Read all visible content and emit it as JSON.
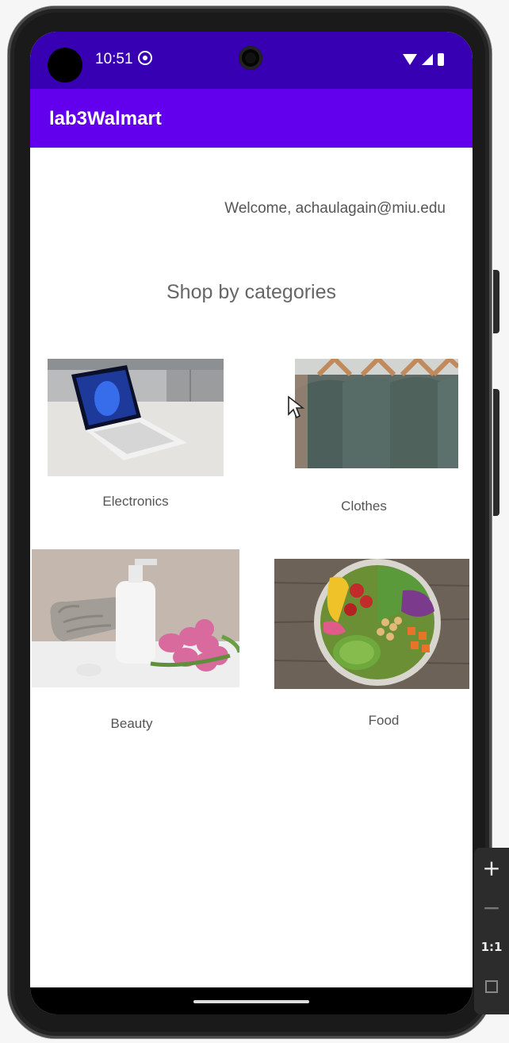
{
  "status_bar": {
    "time": "10:51",
    "icons": [
      "settings-icon",
      "wifi-icon",
      "signal-icon",
      "battery-icon"
    ],
    "background": "#3700b3"
  },
  "app_bar": {
    "title": "lab3Walmart",
    "background": "#6200ee"
  },
  "welcome_text": "Welcome, achaulagain@miu.edu",
  "heading": "Shop by categories",
  "categories": [
    {
      "label": "Electronics",
      "image": "laptop-image"
    },
    {
      "label": "Clothes",
      "image": "shirts-on-hangers-image"
    },
    {
      "label": "Beauty",
      "image": "beauty-products-image"
    },
    {
      "label": "Food",
      "image": "salad-bowl-image"
    }
  ],
  "emulator_controls": {
    "zoom_in": "+",
    "zoom_out": "−",
    "actual_size": "1:1"
  }
}
